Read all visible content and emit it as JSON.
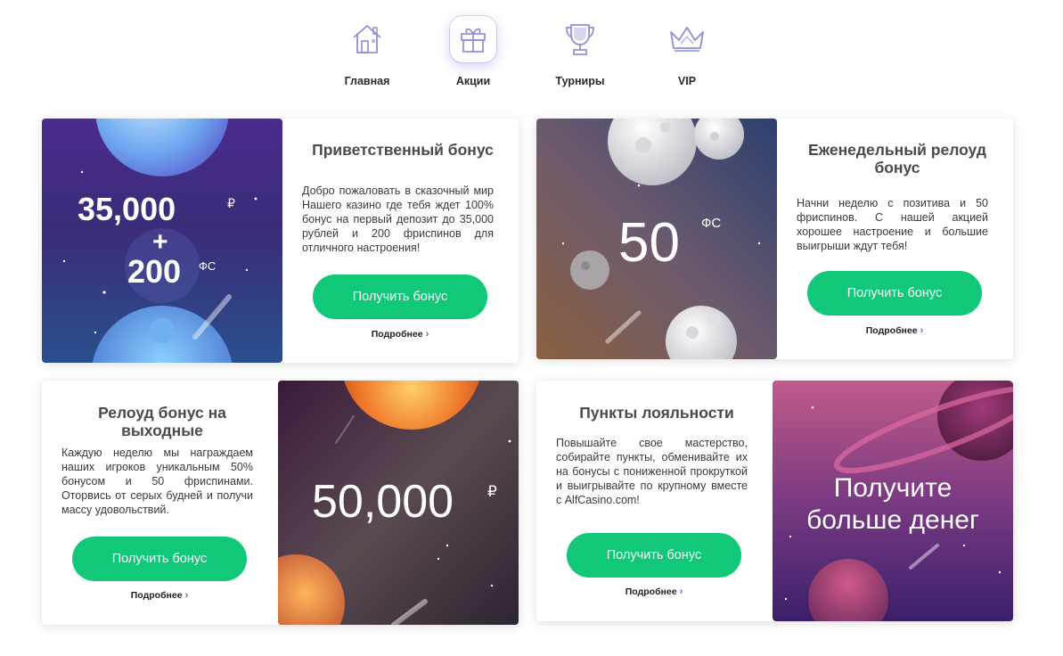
{
  "nav": {
    "items": [
      {
        "label": "Главная",
        "icon": "home-icon"
      },
      {
        "label": "Акции",
        "icon": "gift-icon"
      },
      {
        "label": "Турниры",
        "icon": "trophy-icon"
      },
      {
        "label": "VIP",
        "icon": "crown-icon"
      }
    ],
    "active_index": 1
  },
  "colors": {
    "accent": "#10c877",
    "icon": "#8c8fd6",
    "chevron": "#6b5bc4"
  },
  "promos": [
    {
      "title": "Приветственный бонус",
      "description": "Добро пожаловать в сказочный мир Нашего казино где тебя ждет 100% бонус на первый депозит до 35,000 рублей и 200 фриспинов для отличного настроения!",
      "button": "Получить бонус",
      "more": "Подробнее",
      "image": {
        "amount": "35,000",
        "currency": "₽",
        "plus": "+",
        "spins": "200",
        "spins_unit": "ФС"
      }
    },
    {
      "title": "Еженедельный релоуд бонус",
      "description": "Начни неделю с позитива и 50 фриспинов. С нашей акцией хорошее настроение и большие выигрыши ждут тебя!",
      "button": "Получить бонус",
      "more": "Подробнее",
      "image": {
        "spins": "50",
        "spins_unit": "ФС"
      }
    },
    {
      "title": "Релоуд бонус на выходные",
      "description": "Каждую неделю мы награждаем наших игроков уникальным 50% бонусом и 50 фриспинами. Оторвись от серых будней и получи массу удовольствий.",
      "button": "Получить бонус",
      "more": "Подробнее",
      "image": {
        "amount": "50,000",
        "currency": "₽"
      }
    },
    {
      "title": "Пункты лояльности",
      "description": "Повышайте свое мастерство, собирайте пункты, обменивайте их на бонусы с пониженной прокруткой и выигрывайте по крупному вместе с AlfCasino.com!",
      "button": "Получить бонус",
      "more": "Подробнее",
      "image": {
        "line1": "Получите",
        "line2": "больше денег"
      }
    }
  ]
}
